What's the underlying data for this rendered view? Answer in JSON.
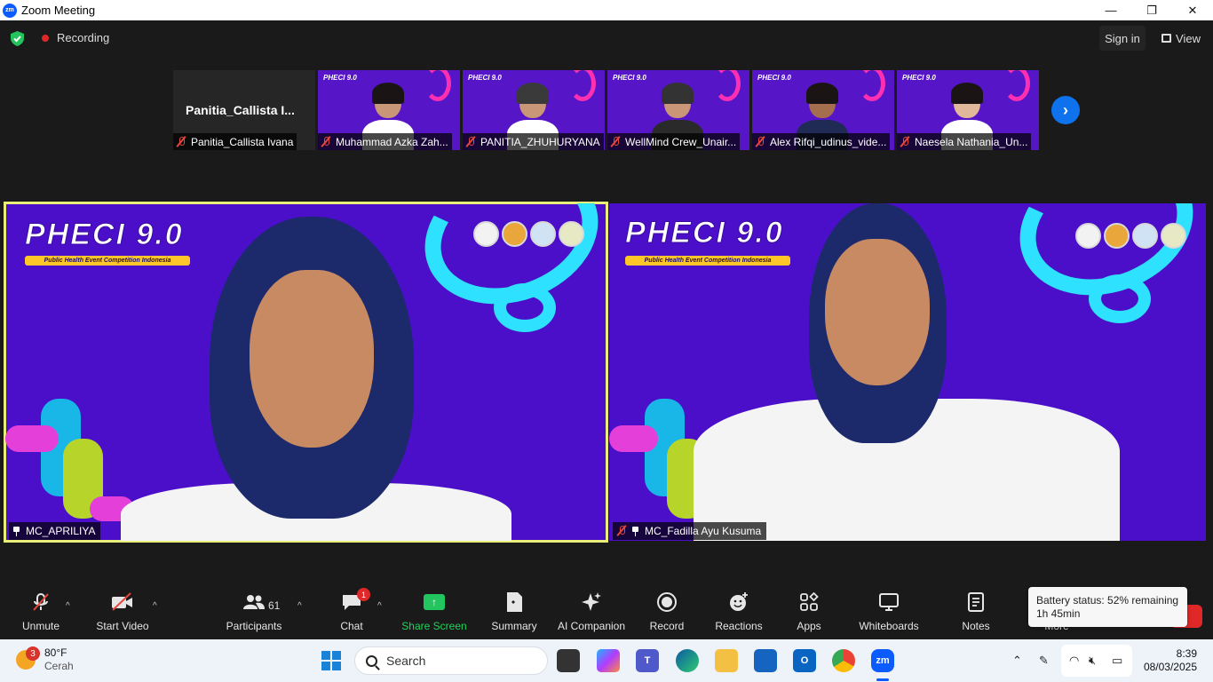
{
  "window": {
    "title": "Zoom Meeting",
    "logo_text": "zm",
    "controls": {
      "minimize": "—",
      "restore": "❐",
      "close": "✕"
    }
  },
  "topbar": {
    "recording_label": "Recording",
    "signin_label": "Sign in",
    "view_label": "View"
  },
  "thumbnails": [
    {
      "name": "Panitia_Callista Ivana",
      "big_name": "Panitia_Callista  I...",
      "video": false
    },
    {
      "name": "Muhammad Azka Zah...",
      "video": true
    },
    {
      "name": "PANITIA_ZHUHURYANA",
      "video": true
    },
    {
      "name": "WellMind Crew_Unair...",
      "video": true
    },
    {
      "name": "Alex Rifqi_udinus_vide...",
      "video": true
    },
    {
      "name": "Naesela Nathania_Un...",
      "video": true
    }
  ],
  "thumbnail_logo": "PHECI 9.0",
  "tiles": [
    {
      "name": "MC_APRILIYA",
      "event_title": "PHECI 9.0",
      "event_subtitle": "Public Health Event Competition Indonesia",
      "speaking": true,
      "muted": false
    },
    {
      "name": "MC_Fadilla Ayu Kusuma",
      "event_title": "PHECI 9.0",
      "event_subtitle": "Public Health Event Competition Indonesia",
      "speaking": false,
      "muted": true
    }
  ],
  "toolbar": {
    "unmute": "Unmute",
    "start_video": "Start Video",
    "participants": "Participants",
    "participants_count": "61",
    "chat": "Chat",
    "chat_badge": "1",
    "share_screen": "Share Screen",
    "summary": "Summary",
    "ai_companion": "AI Companion",
    "record": "Record",
    "reactions": "Reactions",
    "apps": "Apps",
    "whiteboards": "Whiteboards",
    "notes": "Notes",
    "more": "More"
  },
  "tooltip": {
    "line1": "Battery status: 52% remaining",
    "line2": "1h 45min"
  },
  "taskbar": {
    "weather_badge": "3",
    "temperature": "80°F",
    "condition": "Cerah",
    "search_placeholder": "Search",
    "time": "8:39",
    "date": "08/03/2025"
  },
  "colors": {
    "speaking_border": "#e9ee79",
    "zoom_blue": "#0b5cff",
    "share_green": "#22c55e",
    "mute_red": "#e8463c",
    "background_purple": "#4b0fc9"
  }
}
